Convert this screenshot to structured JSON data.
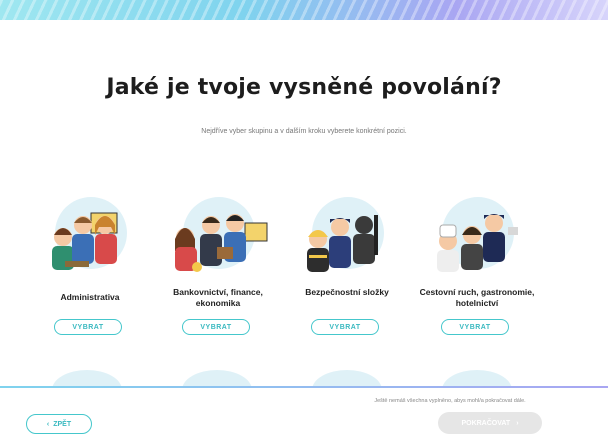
{
  "header": {
    "title": "Jaké je tvoje vysněné povolání?",
    "subtitle": "Nejdříve vyber skupinu a v dalším kroku vyberete konkrétní pozici."
  },
  "cards": [
    {
      "label": "Administrativa",
      "button": "VYBRAT",
      "icon": "office-workers-illustration"
    },
    {
      "label": "Bankovnictví, finance, ekonomika",
      "button": "VYBRAT",
      "icon": "bankers-illustration"
    },
    {
      "label": "Bezpečnostní složky",
      "button": "VYBRAT",
      "icon": "security-forces-illustration"
    },
    {
      "label": "Cestovní ruch, gastronomie, hotelnictví",
      "button": "VYBRAT",
      "icon": "tourism-staff-illustration"
    }
  ],
  "footer": {
    "back_label": "ZPĚT",
    "note": "Ještě nemáš všechna vyplněno, abys mohl/a pokračovat dále.",
    "continue_label": "POKRAČOVAT"
  },
  "colors": {
    "accent": "#45c7cc",
    "bubble": "#dff1f7",
    "disabled": "#e6e6e6"
  }
}
